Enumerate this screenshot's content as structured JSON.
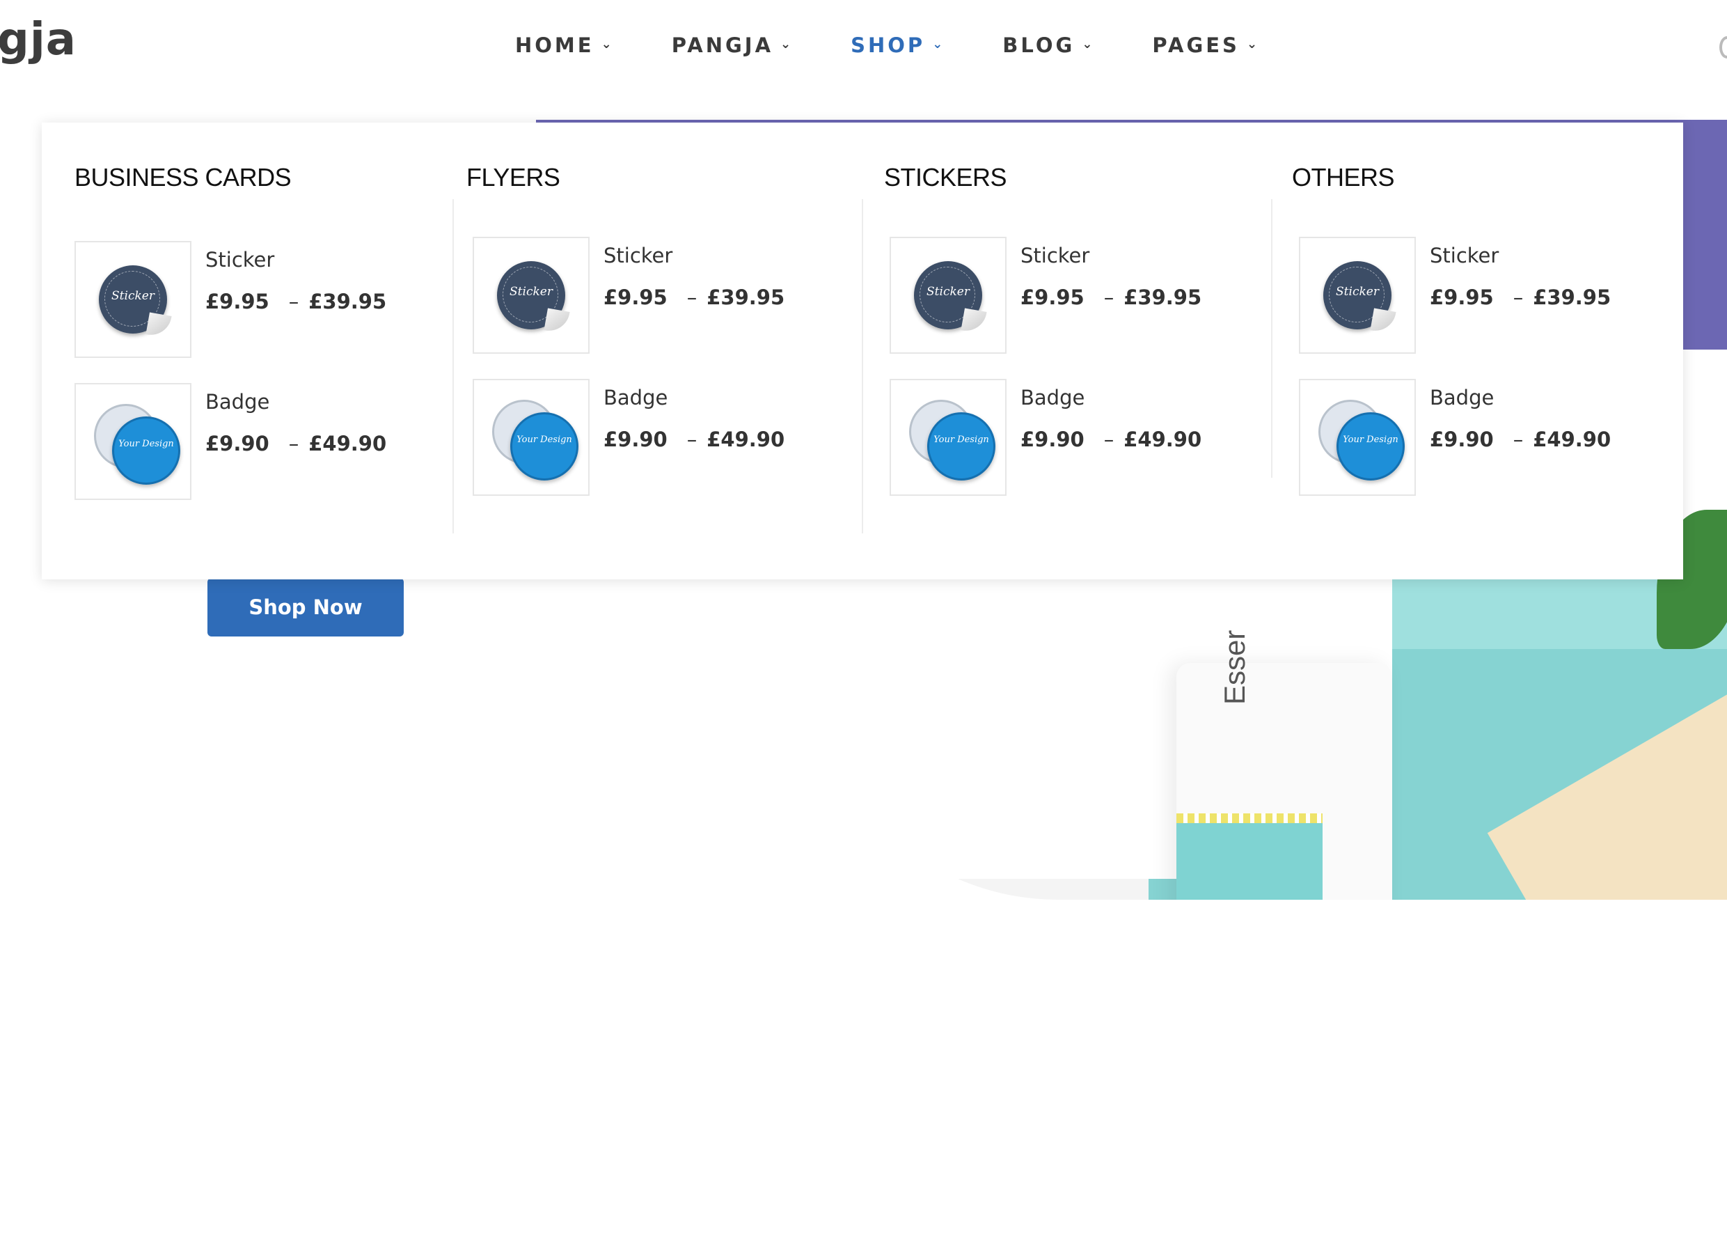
{
  "header": {
    "logo_text": "gja",
    "nav": [
      {
        "label": "HOME",
        "active": false
      },
      {
        "label": "PANGJA",
        "active": false
      },
      {
        "label": "SHOP",
        "active": true
      },
      {
        "label": "BLOG",
        "active": false
      },
      {
        "label": "PAGES",
        "active": false
      }
    ],
    "nav_icon": "chevron-down-icon"
  },
  "hero": {
    "button_label": "Shop Now",
    "pouch_text": "Esser"
  },
  "mega_menu": {
    "columns": [
      {
        "title": "BUSINESS CARDS",
        "products": [
          {
            "name": "Sticker",
            "price_min": "£9.95",
            "price_dash": "–",
            "price_max": "£39.95",
            "thumb_text": "Sticker",
            "icon": "sticker-icon"
          },
          {
            "name": "Badge",
            "price_min": "£9.90",
            "price_dash": "–",
            "price_max": "£49.90",
            "thumb_text": "Your Design",
            "icon": "badge-icon"
          }
        ]
      },
      {
        "title": "FLYERS",
        "products": [
          {
            "name": "Sticker",
            "price_min": "£9.95",
            "price_dash": "–",
            "price_max": "£39.95",
            "thumb_text": "Sticker",
            "icon": "sticker-icon"
          },
          {
            "name": "Badge",
            "price_min": "£9.90",
            "price_dash": "–",
            "price_max": "£49.90",
            "thumb_text": "Your Design",
            "icon": "badge-icon"
          }
        ]
      },
      {
        "title": "STICKERS",
        "products": [
          {
            "name": "Sticker",
            "price_min": "£9.95",
            "price_dash": "–",
            "price_max": "£39.95",
            "thumb_text": "Sticker",
            "icon": "sticker-icon"
          },
          {
            "name": "Badge",
            "price_min": "£9.90",
            "price_dash": "–",
            "price_max": "£49.90",
            "thumb_text": "Your Design",
            "icon": "badge-icon"
          }
        ]
      },
      {
        "title": "OTHERS",
        "products": [
          {
            "name": "Sticker",
            "price_min": "£9.95",
            "price_dash": "–",
            "price_max": "£39.95",
            "thumb_text": "Sticker",
            "icon": "sticker-icon"
          },
          {
            "name": "Badge",
            "price_min": "£9.90",
            "price_dash": "–",
            "price_max": "£49.90",
            "thumb_text": "Your Design",
            "icon": "badge-icon"
          }
        ]
      }
    ]
  },
  "colors": {
    "accent": "#2f6cb8",
    "hero_purple": "#6c67b3",
    "hero_teal": "#86d3d2",
    "sticker_dark": "#3c4d66",
    "badge_blue": "#1e8fd8"
  }
}
